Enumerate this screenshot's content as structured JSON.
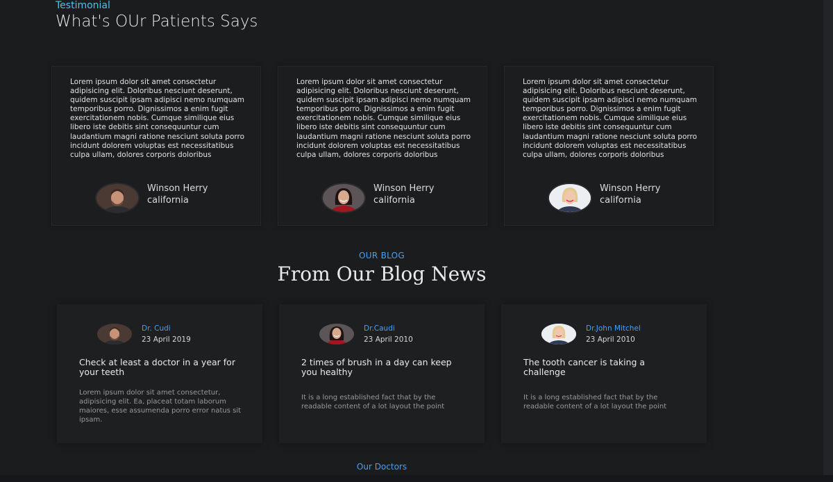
{
  "testimonial": {
    "eyebrow": "Testimonial",
    "title": "What's OUr Patients Says",
    "cards": [
      {
        "text": "Lorem ipsum dolor sit amet consectetur adipisicing elit. Doloribus nesciunt deserunt, quidem suscipit ipsam adipisci nemo numquam temporibus porro. Dignissimos a enim fugit exercitationem nobis. Cumque similique eius libero iste debitis sint consequuntur cum laudantium magni ratione nesciunt soluta porro incidunt dolorem voluptas est necessitatibus culpa ullam, dolores corporis doloribus",
        "name": "Winson Herry",
        "location": "california",
        "avatar": "man-avatar"
      },
      {
        "text": "Lorem ipsum dolor sit amet consectetur adipisicing elit. Doloribus nesciunt deserunt, quidem suscipit ipsam adipisci nemo numquam temporibus porro. Dignissimos a enim fugit exercitationem nobis. Cumque similique eius libero iste debitis sint consequuntur cum laudantium magni ratione nesciunt soluta porro incidunt dolorem voluptas est necessitatibus culpa ullam, dolores corporis doloribus",
        "name": "Winson Herry",
        "location": "california",
        "avatar": "woman-dark-hair-avatar"
      },
      {
        "text": "Lorem ipsum dolor sit amet consectetur adipisicing elit. Doloribus nesciunt deserunt, quidem suscipit ipsam adipisci nemo numquam temporibus porro. Dignissimos a enim fugit exercitationem nobis. Cumque similique eius libero iste debitis sint consequuntur cum laudantium magni ratione nesciunt soluta porro incidunt dolorem voluptas est necessitatibus culpa ullam, dolores corporis doloribus",
        "name": "Winson Herry",
        "location": "california",
        "avatar": "woman-blonde-avatar"
      }
    ]
  },
  "blog": {
    "eyebrow": "OUR BLOG",
    "title": "From Our Blog News",
    "posts": [
      {
        "author": "Dr. Cudi",
        "date": "23 April 2019",
        "title": "Check at least a doctor in a year for your teeth",
        "excerpt": "Lorem ipsum dolor sit amet consectetur, adipisicing elit. Ea, placeat totam laborum maiores, esse assumenda porro error natus sit ipsam.",
        "avatar": "man-avatar"
      },
      {
        "author": "Dr.Caudi",
        "date": "23 April 2010",
        "title": "2 times of brush in a day can keep you healthy",
        "excerpt": "It is a long established fact that by the readable content of a lot layout the point",
        "avatar": "woman-dark-hair-avatar"
      },
      {
        "author": "Dr.John Mitchel",
        "date": "23 April 2010",
        "title": "The tooth cancer is taking a challenge",
        "excerpt": "It is a long established fact that by the readable content of a lot layout the point",
        "avatar": "woman-blonde-avatar"
      }
    ]
  },
  "doctors": {
    "eyebrow": "Our Doctors"
  },
  "colors": {
    "background": "#1b1c1e",
    "accent_cyan": "#4fc3e8",
    "accent_blue": "#4aa0f0",
    "card_border": "#262729"
  }
}
